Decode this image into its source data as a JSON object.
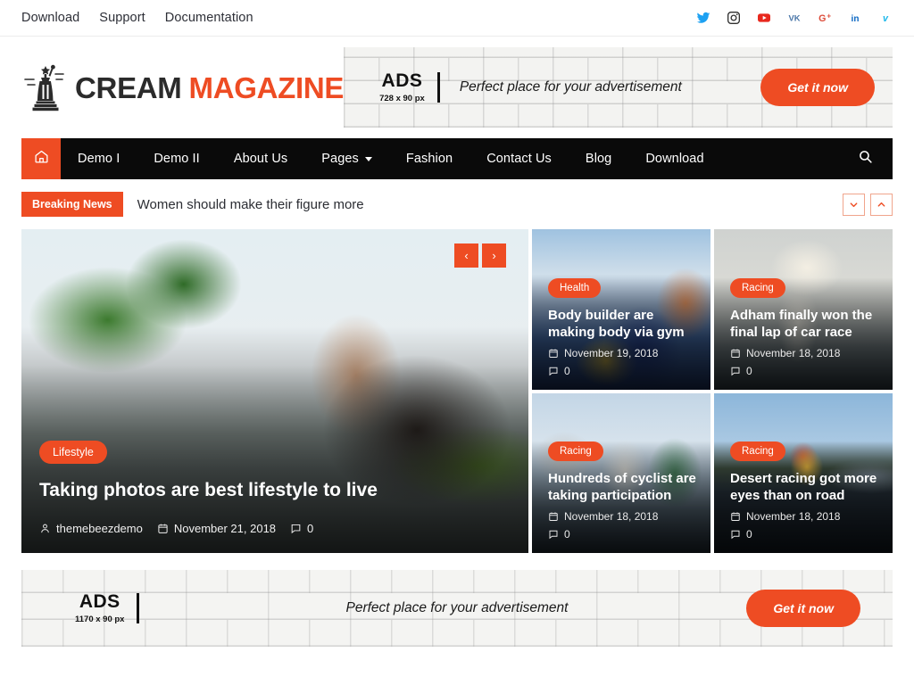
{
  "topbar": {
    "links": [
      {
        "label": "Download"
      },
      {
        "label": "Support"
      },
      {
        "label": "Documentation"
      }
    ],
    "social": [
      {
        "name": "twitter",
        "color": "#1da1f2"
      },
      {
        "name": "instagram",
        "color": "#30302f"
      },
      {
        "name": "youtube",
        "color": "#e8281e"
      },
      {
        "name": "vk",
        "color": "#4a76a8"
      },
      {
        "name": "google-plus",
        "color": "#dd4b39"
      },
      {
        "name": "linkedin",
        "color": "#0a66c2"
      },
      {
        "name": "vimeo",
        "color": "#1ab7ea"
      }
    ]
  },
  "brand": {
    "name_primary": "CREAM",
    "name_accent": "MAGAZINE",
    "accent_color": "#ee4c23",
    "primary_color": "#2b2b2b"
  },
  "ad_top": {
    "ads_word": "ADS",
    "size_label": "728 x 90 px",
    "tagline": "Perfect place for your advertisement",
    "cta_label": "Get it now"
  },
  "nav": {
    "home_icon": "home-icon",
    "items": [
      {
        "label": "Demo I",
        "has_dropdown": false
      },
      {
        "label": "Demo II",
        "has_dropdown": false
      },
      {
        "label": "About Us",
        "has_dropdown": false
      },
      {
        "label": "Pages",
        "has_dropdown": true
      },
      {
        "label": "Fashion",
        "has_dropdown": false
      },
      {
        "label": "Contact Us",
        "has_dropdown": false
      },
      {
        "label": "Blog",
        "has_dropdown": false
      },
      {
        "label": "Download",
        "has_dropdown": false
      }
    ],
    "search_icon": "search-icon"
  },
  "breaking": {
    "badge": "Breaking News",
    "headline": "Women should make their figure more",
    "prev_icon": "chevron-down-icon",
    "next_icon": "chevron-up-icon"
  },
  "hero": {
    "category": "Lifestyle",
    "title": "Taking photos are best lifestyle to live",
    "author": "themebeezdemo",
    "date": "November 21, 2018",
    "comments": "0",
    "prev_label": "‹",
    "next_label": "›"
  },
  "cards": [
    {
      "category": "Health",
      "title": "Body builder are making body via gym",
      "date": "November 19, 2018",
      "comments": "0",
      "image_class": "img-race"
    },
    {
      "category": "Racing",
      "title": "Adham finally won the final lap of car race",
      "date": "November 18, 2018",
      "comments": "0",
      "image_class": "img-scarf"
    },
    {
      "category": "Racing",
      "title": "Hundreds of cyclist are taking participation",
      "date": "November 18, 2018",
      "comments": "0",
      "image_class": "img-cycl"
    },
    {
      "category": "Racing",
      "title": "Desert racing got more eyes than on road",
      "date": "November 18, 2018",
      "comments": "0",
      "image_class": "img-balloon"
    }
  ],
  "ad_bottom": {
    "ads_word": "ADS",
    "size_label": "1170 x 90 px",
    "tagline": "Perfect place for your advertisement",
    "cta_label": "Get it now"
  }
}
